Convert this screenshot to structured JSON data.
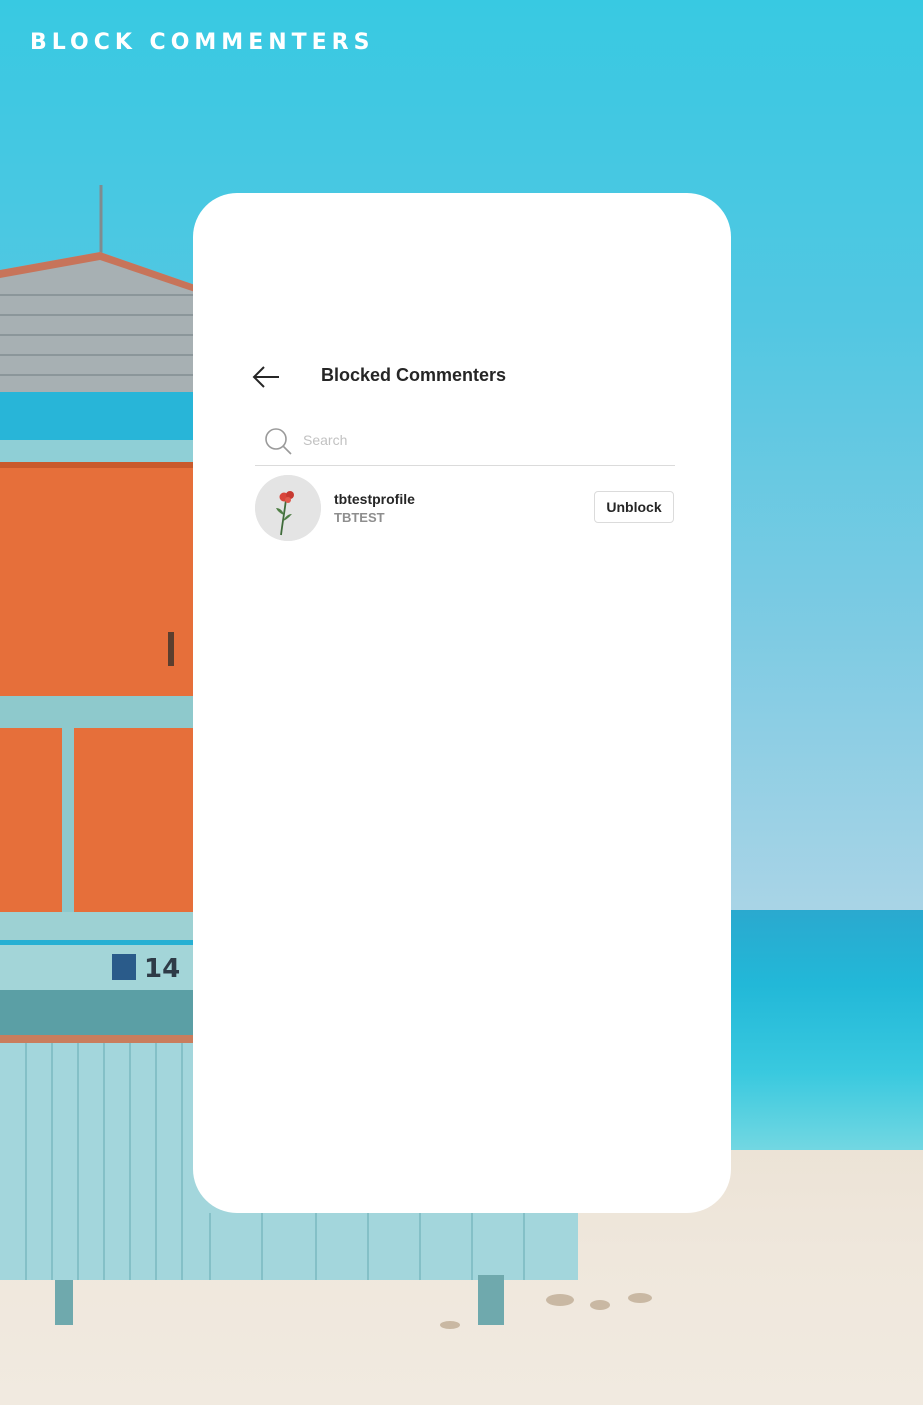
{
  "page": {
    "title": "BLOCK COMMENTERS"
  },
  "screen": {
    "header": {
      "back_icon": "arrow-left-icon",
      "title": "Blocked Commenters"
    },
    "search": {
      "icon": "search-icon",
      "placeholder": "Search",
      "value": ""
    },
    "blocked_users": [
      {
        "username": "tbtestprofile",
        "full_name": "TBTEST",
        "action_label": "Unblock"
      }
    ]
  },
  "colors": {
    "sky": "#38c9e2",
    "card": "#ffffff",
    "text_primary": "#262626",
    "text_secondary": "#8e8e8e",
    "border": "#dbdbdb"
  }
}
